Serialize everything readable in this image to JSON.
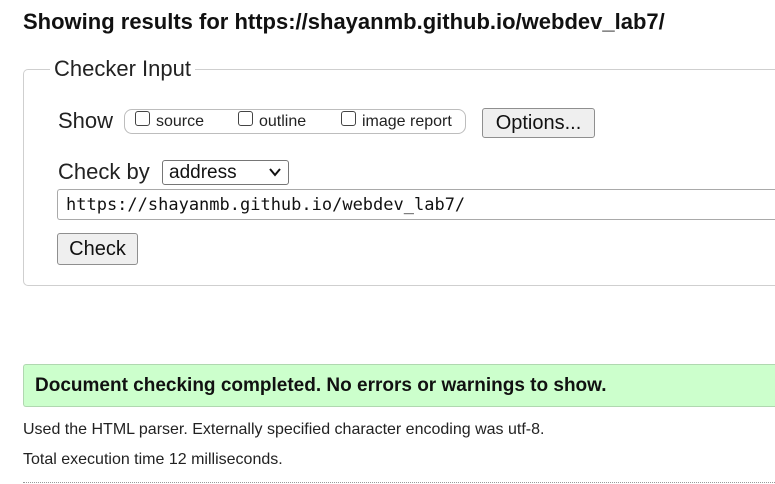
{
  "header": {
    "title": "Showing results for https://shayanmb.github.io/webdev_lab7/"
  },
  "checker": {
    "legend": "Checker Input",
    "show_label": "Show",
    "options": [
      {
        "label": "source",
        "checked": false
      },
      {
        "label": "outline",
        "checked": false
      },
      {
        "label": "image report",
        "checked": false
      }
    ],
    "options_button": "Options...",
    "check_by_label": "Check by",
    "check_by_value": "address",
    "url_value": "https://shayanmb.github.io/webdev_lab7/",
    "check_button": "Check"
  },
  "results": {
    "success_message": "Document checking completed. No errors or warnings to show.",
    "parser_info": "Used the HTML parser. Externally specified character encoding was utf-8.",
    "execution_time": "Total execution time 12 milliseconds."
  },
  "colors": {
    "success_bg": "#ccffcc",
    "button_bg": "#efefef"
  }
}
